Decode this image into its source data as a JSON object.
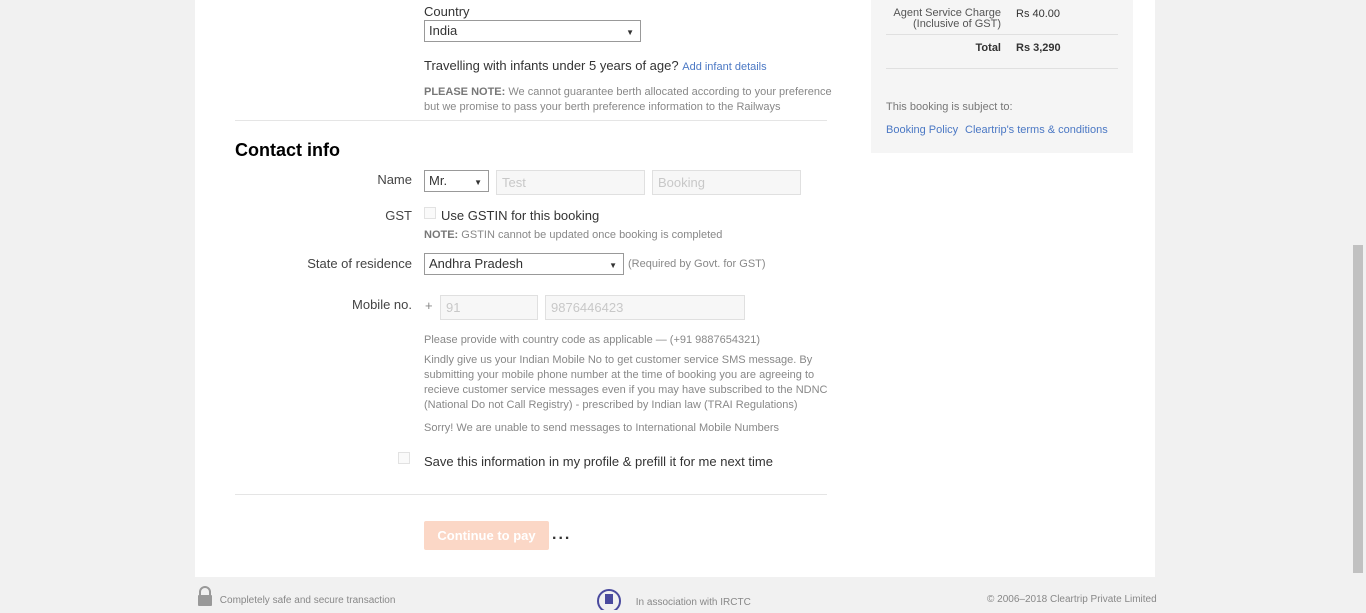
{
  "passenger": {
    "country_label": "Country",
    "country_value": "India",
    "infants_text": "Travelling with infants under 5 years of age?",
    "infants_link": "Add infant details",
    "please_note_bold": "PLEASE NOTE:",
    "please_note_text1": "We cannot guarantee berth allocated according to your preference",
    "please_note_text2": "but we promise to pass your berth preference information to the Railways"
  },
  "contact": {
    "heading": "Contact info",
    "name_label": "Name",
    "title_value": "Mr.",
    "first_name_placeholder": "Test",
    "last_name_placeholder": "Booking",
    "gst_label": "GST",
    "gst_checkbox_label": "Use GSTIN for this booking",
    "gst_note_bold": "NOTE:",
    "gst_note_text": "GSTIN cannot be updated once booking is completed",
    "state_label": "State of residence",
    "state_value": "Andhra Pradesh",
    "state_hint": "(Required by Govt. for GST)",
    "mobile_label": "Mobile no.",
    "plus": "+",
    "country_code_placeholder": "91",
    "mobile_placeholder": "9876446423",
    "mobile_hint": "Please provide with country code as applicable — (+91 9887654321)",
    "sms_text1": "Kindly give us your Indian Mobile No to get customer service SMS message. By",
    "sms_text2": "submitting your mobile phone number at the time of booking you are agreeing to",
    "sms_text3": "recieve customer service messages even if you may have subscribed to the NDNC",
    "sms_text4": "(National Do not Call Registry) - prescribed by Indian law (TRAI Regulations)",
    "intl_text": "Sorry! We are unable to send messages to International Mobile Numbers",
    "save_label": "Save this information in my profile & prefill it for me next time",
    "continue_label": "Continue to pay",
    "loading_dots": "..."
  },
  "summary": {
    "agent_charge_label1": "Agent Service Charge",
    "agent_charge_label2": "(Inclusive of GST)",
    "agent_charge_value": "Rs 40.00",
    "total_label": "Total",
    "total_value": "Rs 3,290",
    "subject_text": "This booking is subject to:",
    "booking_policy_link": "Booking Policy",
    "terms_link": "Cleartrip's terms & conditions"
  },
  "footer": {
    "secure_text": "Completely safe and secure transaction",
    "irctc_text": "In association with IRCTC",
    "copyright_text": "© 2006–2018 Cleartrip Private Limited"
  },
  "colors": {
    "link": "#4b78c4",
    "button_disabled": "#fbd7c6"
  },
  "icons": [
    "lock-icon",
    "irctc-logo-icon",
    "dropdown-arrow-icon"
  ]
}
